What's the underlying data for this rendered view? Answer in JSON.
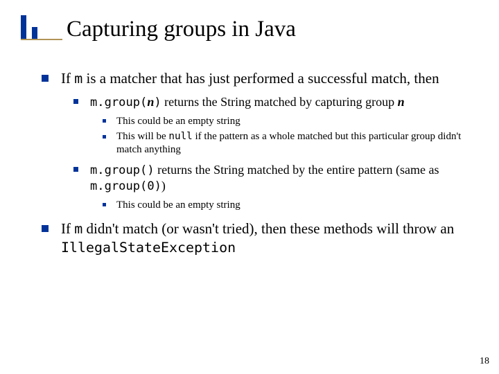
{
  "title": "Capturing groups in Java",
  "slide_number": "18",
  "colors": {
    "accent": "#003399",
    "underline": "#b19455"
  },
  "b1": {
    "pre": "If ",
    "m": "m",
    "post": " is a matcher that has just performed a successful match, then"
  },
  "b1_1": {
    "code": "m.group(",
    "n": "n",
    "code2": ")",
    "post": " returns the String matched by capturing group ",
    "n2": "n"
  },
  "b1_1_1": "This could be an empty string",
  "b1_1_2": {
    "pre": "This will be ",
    "null": "null",
    "post": " if the pattern as a whole matched but this particular group didn't match anything"
  },
  "b1_2": {
    "code1": "m.group()",
    "mid": " returns the String matched by the entire pattern (same as ",
    "code2": "m.group(0)",
    "end": ")"
  },
  "b1_2_1": "This could be an empty string",
  "b2": {
    "pre": "If ",
    "m": "m",
    "mid": " didn't match (or wasn't tried), then these methods will throw an ",
    "exc": "IllegalStateException"
  }
}
